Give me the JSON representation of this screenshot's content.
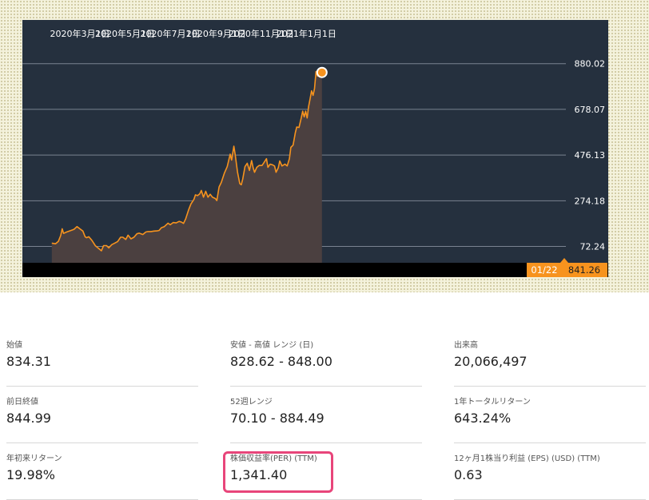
{
  "chart_data": {
    "type": "area",
    "x_tick_labels": [
      "2020年3月1日",
      "2020年5月1日",
      "2020年7月1日",
      "2020年9月1日",
      "2020年11月1日",
      "2021年1月1日"
    ],
    "y_tick_labels": [
      "880.02",
      "678.07",
      "476.13",
      "274.18",
      "72.24"
    ],
    "ylim": [
      0,
      960
    ],
    "grid": true,
    "colors": {
      "plot_bg": "#25303e",
      "line": "#f7931e",
      "fill": "#4b4040",
      "axis_bar": "#000000",
      "grid": "#7a8390",
      "badge": "#f7931e"
    },
    "current_date_label": "01/22",
    "current_value_label": "841.26",
    "series": [
      {
        "values": [
          [
            "2020-01-23",
            87
          ],
          [
            "2020-01-28",
            84
          ],
          [
            "2020-02-01",
            95
          ],
          [
            "2020-02-04",
            120
          ],
          [
            "2020-02-06",
            150
          ],
          [
            "2020-02-08",
            130
          ],
          [
            "2020-02-12",
            136
          ],
          [
            "2020-02-18",
            143
          ],
          [
            "2020-02-22",
            148
          ],
          [
            "2020-02-26",
            160
          ],
          [
            "2020-03-01",
            150
          ],
          [
            "2020-03-05",
            140
          ],
          [
            "2020-03-08",
            115
          ],
          [
            "2020-03-10",
            111
          ],
          [
            "2020-03-13",
            115
          ],
          [
            "2020-03-17",
            100
          ],
          [
            "2020-03-20",
            85
          ],
          [
            "2020-03-22",
            75
          ],
          [
            "2020-03-26",
            64
          ],
          [
            "2020-03-30",
            53
          ],
          [
            "2020-04-02",
            76
          ],
          [
            "2020-04-06",
            76
          ],
          [
            "2020-04-09",
            66
          ],
          [
            "2020-04-13",
            80
          ],
          [
            "2020-04-17",
            87
          ],
          [
            "2020-04-21",
            94
          ],
          [
            "2020-04-25",
            113
          ],
          [
            "2020-04-28",
            113
          ],
          [
            "2020-05-02",
            103
          ],
          [
            "2020-05-05",
            122
          ],
          [
            "2020-05-09",
            106
          ],
          [
            "2020-05-13",
            113
          ],
          [
            "2020-05-17",
            128
          ],
          [
            "2020-05-20",
            131
          ],
          [
            "2020-05-25",
            125
          ],
          [
            "2020-05-29",
            136
          ],
          [
            "2020-06-01",
            138
          ],
          [
            "2020-06-05",
            138
          ],
          [
            "2020-06-09",
            140
          ],
          [
            "2020-06-13",
            141
          ],
          [
            "2020-06-16",
            143
          ],
          [
            "2020-06-19",
            155
          ],
          [
            "2020-06-23",
            160
          ],
          [
            "2020-06-28",
            175
          ],
          [
            "2020-07-01",
            168
          ],
          [
            "2020-07-05",
            178
          ],
          [
            "2020-07-09",
            176
          ],
          [
            "2020-07-13",
            183
          ],
          [
            "2020-07-16",
            180
          ],
          [
            "2020-07-19",
            174
          ],
          [
            "2020-07-22",
            195
          ],
          [
            "2020-07-26",
            235
          ],
          [
            "2020-07-29",
            260
          ],
          [
            "2020-08-02",
            280
          ],
          [
            "2020-08-04",
            300
          ],
          [
            "2020-08-07",
            297
          ],
          [
            "2020-08-10",
            305
          ],
          [
            "2020-08-12",
            320
          ],
          [
            "2020-08-15",
            290
          ],
          [
            "2020-08-18",
            316
          ],
          [
            "2020-08-21",
            290
          ],
          [
            "2020-08-24",
            303
          ],
          [
            "2020-08-27",
            290
          ],
          [
            "2020-08-31",
            284
          ],
          [
            "2020-09-02",
            275
          ],
          [
            "2020-09-05",
            335
          ],
          [
            "2020-09-08",
            355
          ],
          [
            "2020-09-12",
            395
          ],
          [
            "2020-09-16",
            425
          ],
          [
            "2020-09-20",
            480
          ],
          [
            "2020-09-22",
            454
          ],
          [
            "2020-09-25",
            515
          ],
          [
            "2020-09-27",
            472
          ],
          [
            "2020-09-30",
            400
          ],
          [
            "2020-10-03",
            350
          ],
          [
            "2020-10-05",
            345
          ],
          [
            "2020-10-07",
            370
          ],
          [
            "2020-10-10",
            425
          ],
          [
            "2020-10-13",
            440
          ],
          [
            "2020-10-16",
            408
          ],
          [
            "2020-10-19",
            452
          ],
          [
            "2020-10-21",
            420
          ],
          [
            "2020-10-23",
            400
          ],
          [
            "2020-10-26",
            422
          ],
          [
            "2020-10-29",
            430
          ],
          [
            "2020-11-02",
            430
          ],
          [
            "2020-11-04",
            440
          ],
          [
            "2020-11-08",
            460
          ],
          [
            "2020-11-10",
            422
          ],
          [
            "2020-11-13",
            436
          ],
          [
            "2020-11-16",
            433
          ],
          [
            "2020-11-19",
            428
          ],
          [
            "2020-11-21",
            400
          ],
          [
            "2020-11-24",
            420
          ],
          [
            "2020-11-26",
            450
          ],
          [
            "2020-11-29",
            428
          ],
          [
            "2020-12-03",
            436
          ],
          [
            "2020-12-06",
            428
          ],
          [
            "2020-12-09",
            460
          ],
          [
            "2020-12-11",
            510
          ],
          [
            "2020-12-14",
            520
          ],
          [
            "2020-12-17",
            575
          ],
          [
            "2020-12-19",
            600
          ],
          [
            "2020-12-22",
            598
          ],
          [
            "2020-12-25",
            640
          ],
          [
            "2020-12-27",
            670
          ],
          [
            "2020-12-29",
            645
          ],
          [
            "2020-12-31",
            670
          ],
          [
            "2021-01-02",
            640
          ],
          [
            "2021-01-04",
            690
          ],
          [
            "2021-01-06",
            725
          ],
          [
            "2021-01-08",
            760
          ],
          [
            "2021-01-10",
            740
          ],
          [
            "2021-01-12",
            770
          ],
          [
            "2021-01-14",
            845
          ],
          [
            "2021-01-16",
            825
          ],
          [
            "2021-01-18",
            840
          ],
          [
            "2021-01-20",
            845
          ],
          [
            "2021-01-22",
            841.26
          ]
        ]
      }
    ]
  },
  "stats": [
    {
      "label": "始値",
      "value": "834.31"
    },
    {
      "label": "安値 - 高値 レンジ (日)",
      "value": "828.62 - 848.00"
    },
    {
      "label": "出来高",
      "value": "20,066,497"
    },
    {
      "label": "前日終値",
      "value": "844.99"
    },
    {
      "label": "52週レンジ",
      "value": "70.10 - 884.49"
    },
    {
      "label": "1年トータルリターン",
      "value": "643.24%"
    },
    {
      "label": "年初来リターン",
      "value": "19.98%"
    },
    {
      "label": "株価収益率(PER) (TTM)",
      "value": "1,341.40"
    },
    {
      "label": "12ヶ月1株当り利益 (EPS) (USD) (TTM)",
      "value": "0.63"
    }
  ]
}
